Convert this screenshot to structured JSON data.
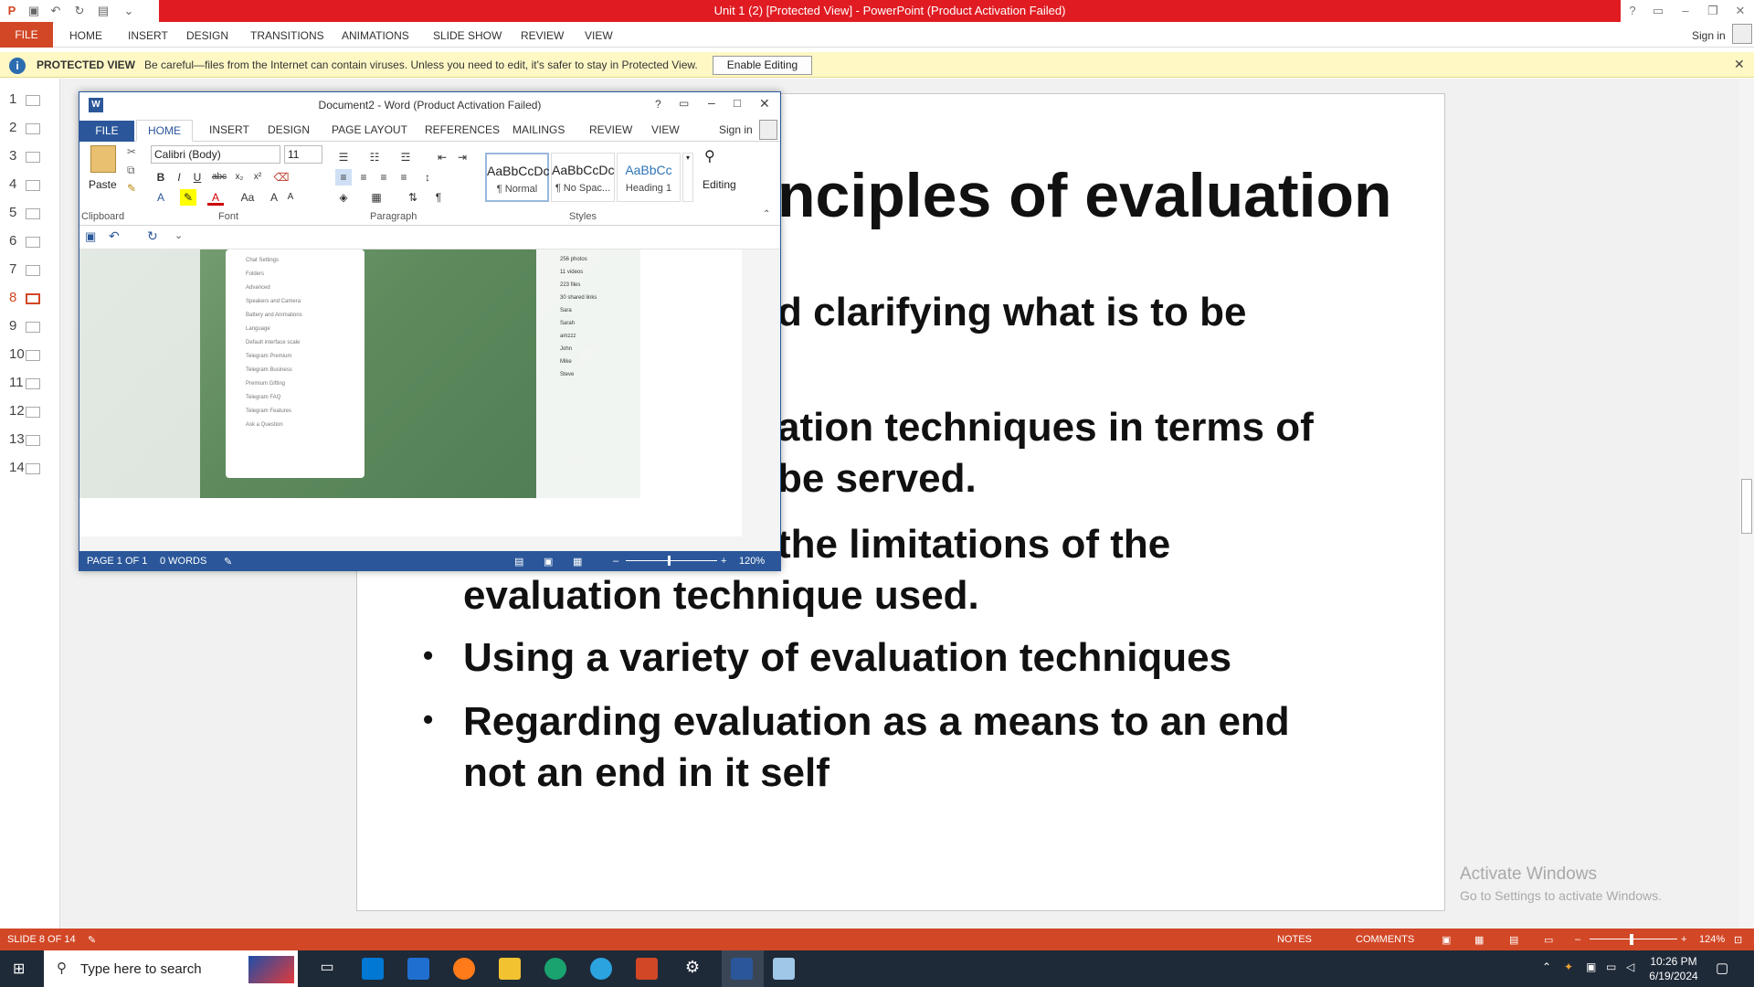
{
  "ppt": {
    "title": "Unit 1 (2) [Protected View] - PowerPoint (Product Activation Failed)",
    "tabs": [
      "FILE",
      "HOME",
      "INSERT",
      "DESIGN",
      "TRANSITIONS",
      "ANIMATIONS",
      "SLIDE SHOW",
      "REVIEW",
      "VIEW"
    ],
    "sign_in": "Sign in",
    "protected": {
      "label": "PROTECTED VIEW",
      "message": "Be careful—files from the Internet can contain viruses. Unless you need to edit, it's safer to stay in Protected View.",
      "button": "Enable Editing"
    },
    "slides": [
      "1",
      "2",
      "3",
      "4",
      "5",
      "6",
      "7",
      "8",
      "9",
      "10",
      "11",
      "12",
      "13",
      "14"
    ],
    "selected_slide": "8",
    "slide": {
      "title": "nciples of evaluation",
      "lines": [
        "d clarifying what is to be",
        "ation techniques in terms of",
        "be served.",
        "the limitations of the",
        "evaluation technique used.",
        "Using a variety of evaluation techniques",
        "Regarding evaluation as a means to an end",
        "not an end in it self"
      ],
      "bullet": "•"
    },
    "watermark": {
      "line1": "Activate Windows",
      "line2": "Go to Settings to activate Windows."
    },
    "status": {
      "slide": "SLIDE 8 OF 14",
      "notes": "NOTES",
      "comments": "COMMENTS",
      "zoom": "124%"
    }
  },
  "word": {
    "title": "Document2 - Word (Product Activation Failed)",
    "tabs": [
      "FILE",
      "HOME",
      "INSERT",
      "DESIGN",
      "PAGE LAYOUT",
      "REFERENCES",
      "MAILINGS",
      "REVIEW",
      "VIEW"
    ],
    "sign_in": "Sign in",
    "font": "Calibri (Body)",
    "size": "11",
    "paste": "Paste",
    "editing": "Editing",
    "styles": [
      {
        "sample": "AaBbCcDc",
        "name": "¶ Normal"
      },
      {
        "sample": "AaBbCcDc",
        "name": "¶ No Spac..."
      },
      {
        "sample": "AaBbCc",
        "name": "Heading 1"
      }
    ],
    "groups": [
      "Clipboard",
      "Font",
      "Paragraph",
      "Styles"
    ],
    "screenshot_menu": [
      "Chat Settings",
      "Folders",
      "Advanced",
      "Speakers and Camera",
      "Battery and Animations",
      "Language",
      "Default interface scale",
      "Telegram Premium",
      "Telegram Business",
      "Premium Gifting",
      "Telegram FAQ",
      "Telegram Features",
      "Ask a Question"
    ],
    "screenshot_right": [
      "256 photos",
      "11 videos",
      "223 files",
      "30 shared links",
      "Sara",
      "Sarah",
      "amzzz",
      "John",
      "Mike",
      "Steve"
    ],
    "status": {
      "page": "PAGE 1 OF 1",
      "words": "0 WORDS",
      "zoom": "120%"
    }
  },
  "taskbar": {
    "search": "Type here to search",
    "time": "10:26 PM",
    "date": "6/19/2024"
  }
}
